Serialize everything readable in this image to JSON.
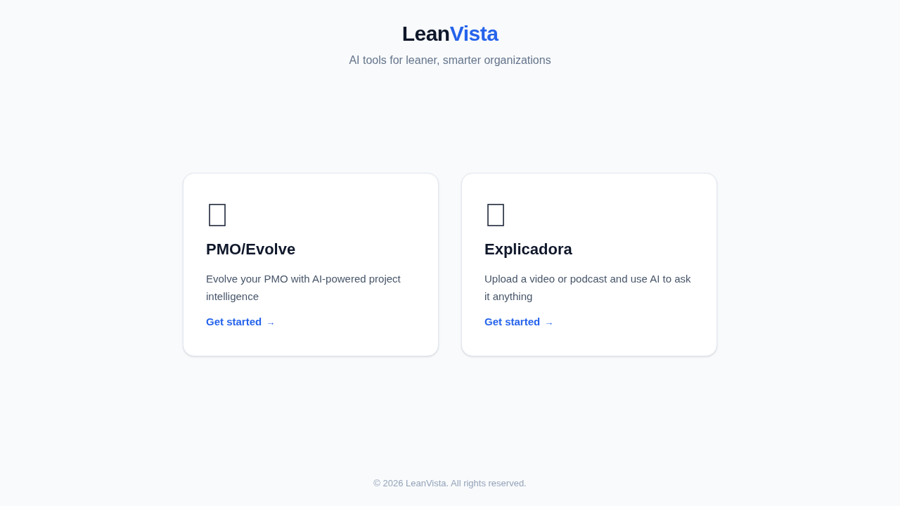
{
  "header": {
    "logo": {
      "first": "Lean",
      "accent": "Vista"
    },
    "tagline": "AI tools for leaner, smarter organizations"
  },
  "cards": [
    {
      "title": "PMO/Evolve",
      "description": "Evolve your PMO with AI-powered project intelligence",
      "link": {
        "label": "Get started",
        "arrow": "→"
      }
    },
    {
      "title": "Explicadora",
      "description": "Upload a video or podcast and use AI to ask it anything",
      "link": {
        "label": "Get started",
        "arrow": "→"
      }
    }
  ],
  "footer": {
    "text": "© 2026 LeanVista. All rights reserved."
  }
}
